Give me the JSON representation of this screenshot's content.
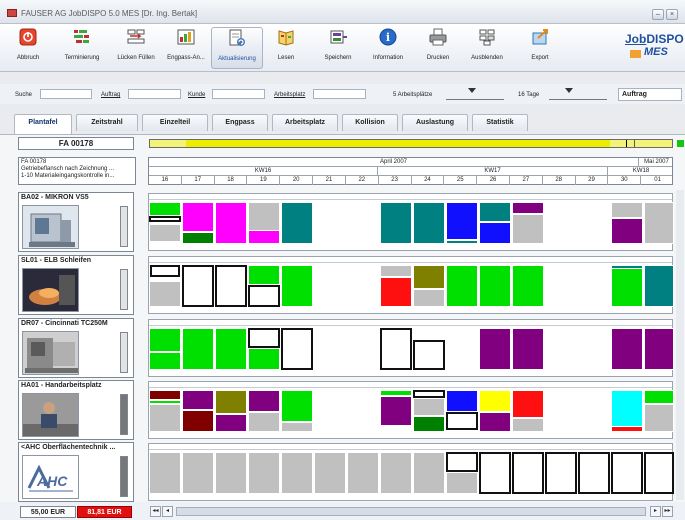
{
  "window": {
    "title": "FAUSER AG JobDISPO 5.0 MES  [Dr. Ing. Bertak]"
  },
  "toolbar": [
    {
      "label": "Abbruch",
      "icon": "cancel-icon",
      "color": "#e8442c"
    },
    {
      "label": "Terminierung",
      "icon": "schedule-icon",
      "color": "#3aa83a"
    },
    {
      "label": "Lücken Füllen",
      "icon": "fill-gaps-icon",
      "color": "#c03030"
    },
    {
      "label": "Engpass-An...",
      "icon": "bottleneck-icon",
      "color": "#3a8a3a"
    },
    {
      "label": "Aktualisierung",
      "icon": "refresh-icon",
      "color": "#4a7ab0"
    },
    {
      "label": "Lesen",
      "icon": "read-icon",
      "color": "#e0a020"
    },
    {
      "label": "Speichern",
      "icon": "save-icon",
      "color": "#6a40a0"
    },
    {
      "label": "Information",
      "icon": "info-icon",
      "color": "#2a6ac8"
    },
    {
      "label": "Drucken",
      "icon": "print-icon",
      "color": "#666666"
    },
    {
      "label": "Ausblenden",
      "icon": "hide-icon",
      "color": "#555555"
    },
    {
      "label": "Export",
      "icon": "export-icon",
      "color": "#2a7ab8"
    }
  ],
  "logo": {
    "line1_prefix": "Job",
    "line1_suffix": "DISPO",
    "line2": "MES"
  },
  "filters": {
    "search_label": "Suche",
    "order_label": "Auftrag",
    "customer_label": "Kunde",
    "workplace_label": "Arbeitsplatz",
    "workplaces_count": "5 Arbeitsplätze",
    "days_count": "16 Tage",
    "group_by": "Auftrag"
  },
  "tabs": [
    "Plantafel",
    "Zeitstrahl",
    "Einzelteil",
    "Engpass",
    "Arbeitsplatz",
    "Kollision",
    "Auslastung",
    "Statistik"
  ],
  "active_tab": "Plantafel",
  "order": {
    "number": "FA 00178",
    "info_line1": "FA 00178",
    "info_line2": "Getriebeflansch nach Zeichnung ...",
    "info_line3": "1-10 Materialeingangskontrolle in..."
  },
  "timeline": {
    "months": [
      {
        "label": "April 2007"
      },
      {
        "label": "Mai 2007"
      }
    ],
    "weeks": [
      "KW16",
      "KW17",
      "KW18"
    ],
    "days": [
      "16",
      "17",
      "18",
      "19",
      "20",
      "21",
      "22",
      "23",
      "24",
      "25",
      "26",
      "27",
      "28",
      "29",
      "30",
      "01"
    ]
  },
  "machines": [
    {
      "name": "BA02 - MIKRON VS5",
      "image": "machine-photo-mikron"
    },
    {
      "name": "SL01 - ELB Schleifen",
      "image": "machine-photo-grinding"
    },
    {
      "name": "DR07 - Cincinnati TC250M",
      "image": "machine-photo-lathe"
    },
    {
      "name": "HA01 - Handarbeitsplatz",
      "image": "machine-photo-manual"
    },
    {
      "name": "<AHC Oberflächentechnik ...",
      "image": "ahc-logo"
    }
  ],
  "footer": {
    "cost_actual": "55,00 EUR",
    "cost_planned": "81,81 EUR"
  },
  "colors": {
    "magenta": "#ff00ff",
    "green": "#00e000",
    "teal": "#008080",
    "purple": "#800080",
    "blue": "#1010ff",
    "red": "#ff1010",
    "olive": "#808000",
    "darkred": "#800000",
    "cyan": "#00ffff",
    "yellow": "#ffff00",
    "grey": "#c0c0c0",
    "darkgreen": "#008000"
  }
}
